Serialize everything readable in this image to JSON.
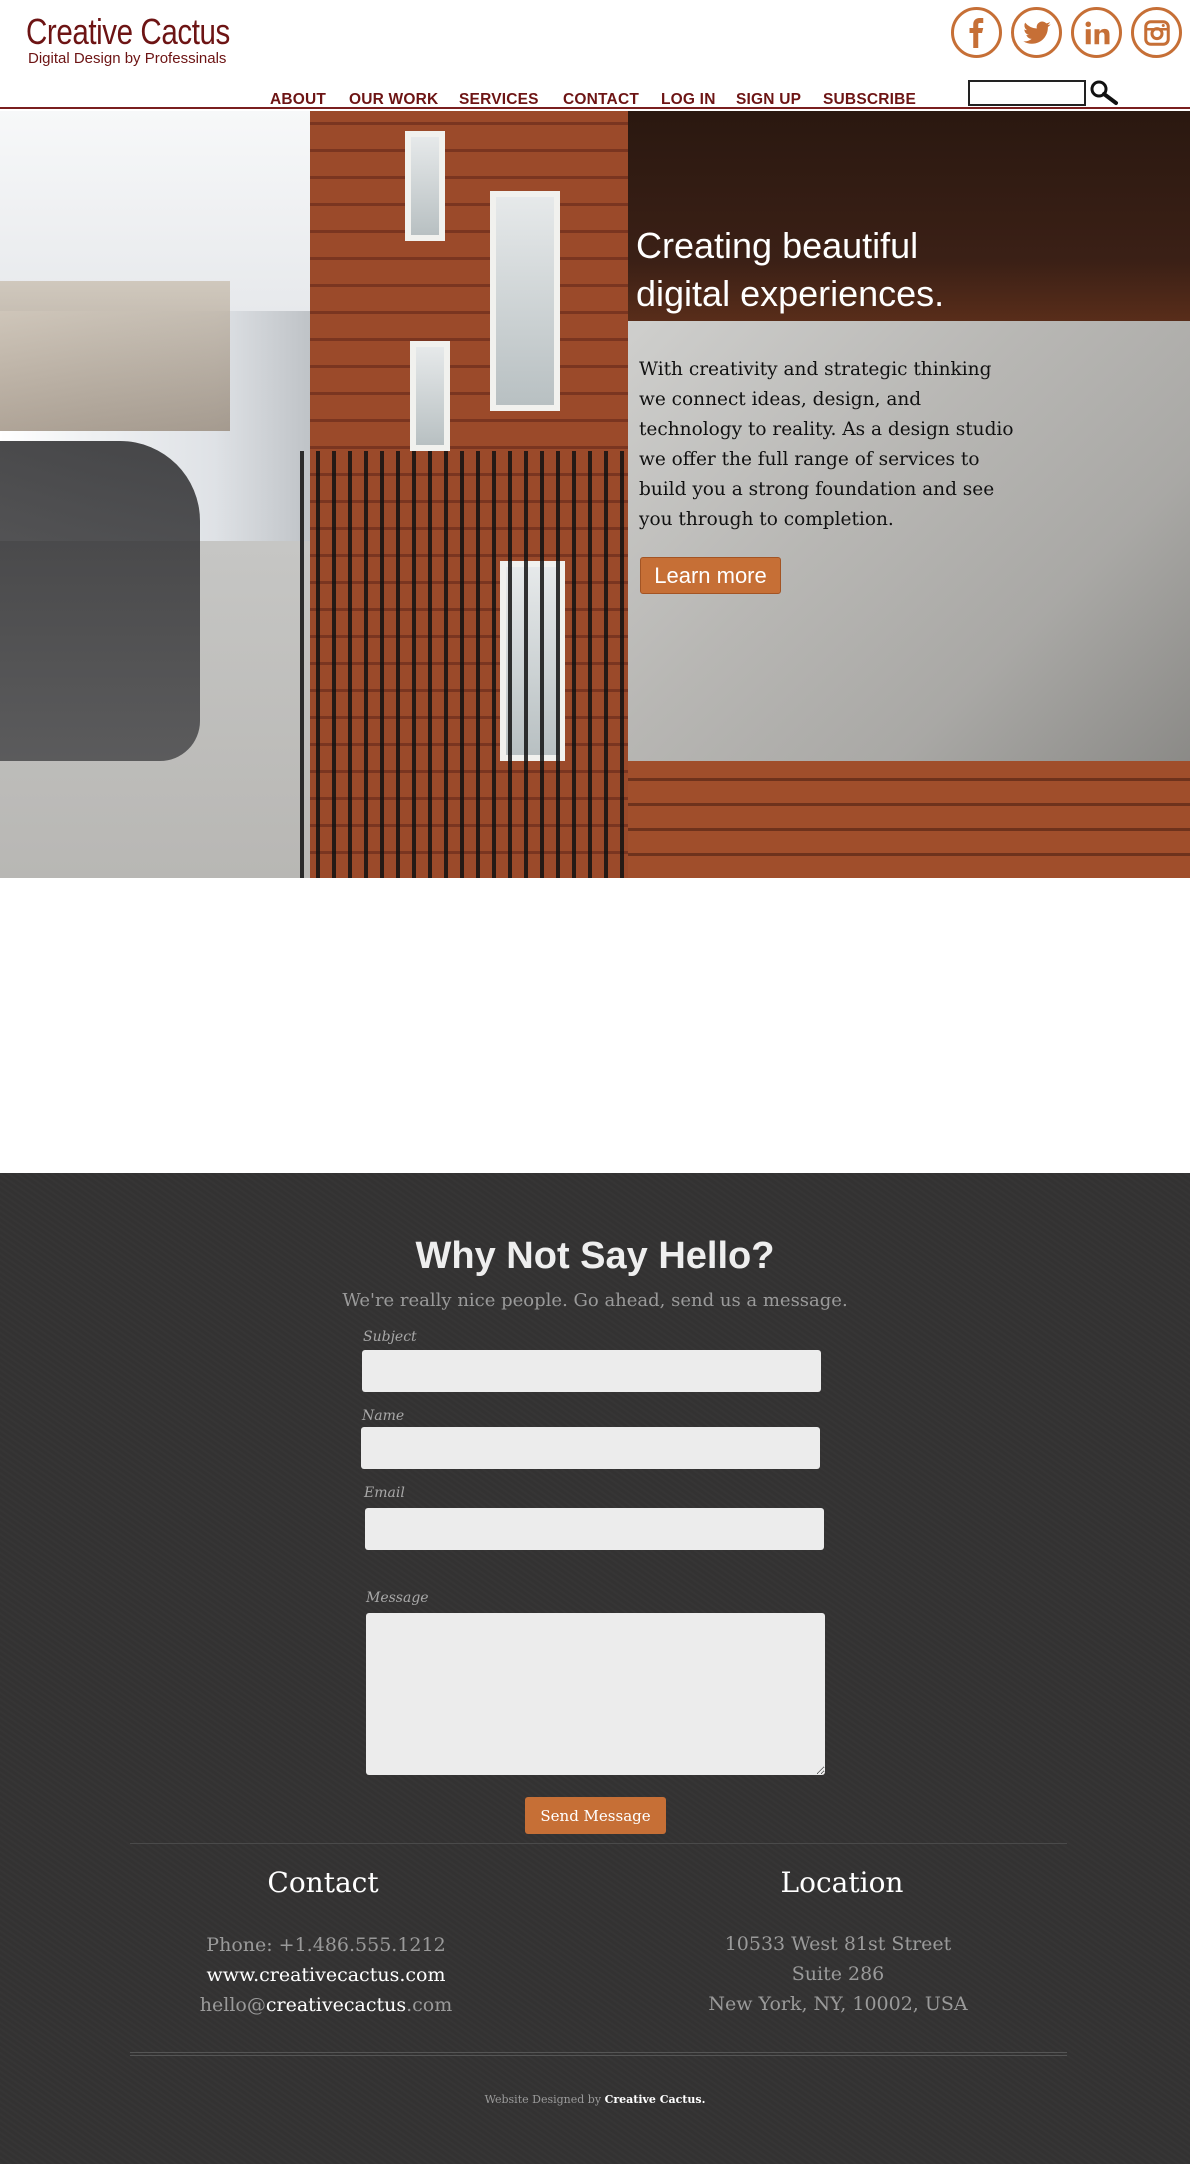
{
  "brand": {
    "title": "Creative Cactus",
    "tagline": "Digital Design by Professinals"
  },
  "social": [
    {
      "name": "facebook-icon"
    },
    {
      "name": "twitter-icon"
    },
    {
      "name": "linkedin-icon"
    },
    {
      "name": "instagram-icon"
    }
  ],
  "nav": {
    "about": "ABOUT",
    "our_work": "OUR WORK",
    "services": "SERVICES",
    "contact": "CONTACT",
    "log_in": "LOG IN",
    "sign_up": "SIGN UP",
    "subscribe": "SUBSCRIBE"
  },
  "search": {
    "value": "",
    "placeholder": ""
  },
  "hero": {
    "title_line1": "Creating beautiful",
    "title_line2": "digital experiences.",
    "body": "With creativity and strategic thinking we connect ideas, design, and technology to reality. As a design studio we offer the full range of services to build you a strong foundation and see you through to completion.",
    "button": "Learn more"
  },
  "contact_form": {
    "title": "Why Not Say Hello?",
    "subtitle": "We're really nice people. Go ahead, send us a message.",
    "subject_label": "Subject",
    "name_label": "Name",
    "email_label": "Email",
    "message_label": "Message",
    "send_button": "Send Message"
  },
  "footer": {
    "contact_title": "Contact",
    "phone": "Phone: +1.486.555.1212",
    "website": "www.creativecactus.com",
    "email_prefix": "hello@",
    "email_domain": "creativecactus",
    "email_suffix": ".com",
    "location_title": "Location",
    "address1": "10533 West 81st Street",
    "address2": "Suite 286",
    "address3": "New York, NY, 10002, USA",
    "credit_prefix": "Website Designed by",
    "credit_name": "Creative Cactus."
  },
  "colors": {
    "brand": "#6d1414",
    "accent": "#c66f36",
    "dark_bg": "#333232"
  }
}
